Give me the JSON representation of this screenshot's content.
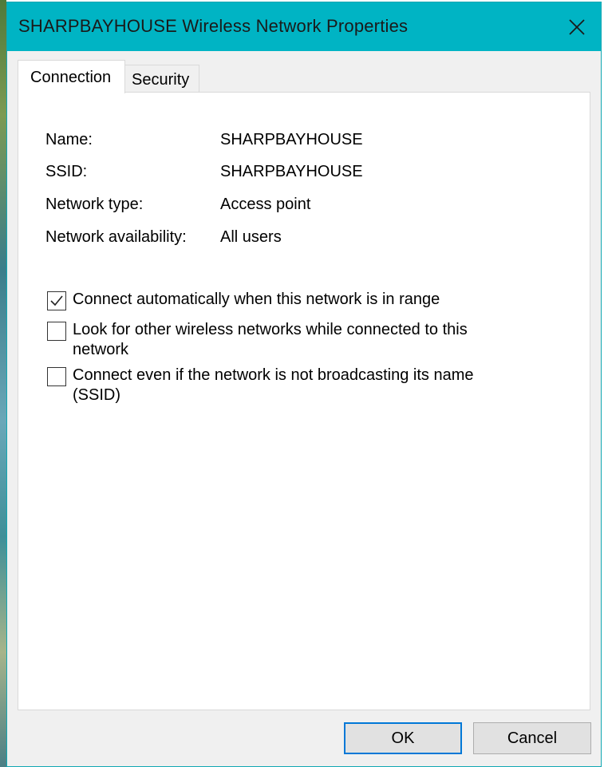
{
  "window": {
    "title": "SHARPBAYHOUSE Wireless Network Properties"
  },
  "icons": {
    "close": "close-icon",
    "check": "checkmark-icon"
  },
  "tabs": [
    {
      "label": "Connection",
      "active": true
    },
    {
      "label": "Security",
      "active": false
    }
  ],
  "properties": [
    {
      "label": "Name:",
      "value": "SHARPBAYHOUSE"
    },
    {
      "label": "SSID:",
      "value": "SHARPBAYHOUSE"
    },
    {
      "label": "Network type:",
      "value": "Access point"
    },
    {
      "label": "Network availability:",
      "value": "All users"
    }
  ],
  "options": [
    {
      "label": "Connect automatically when this network is in range",
      "checked": true
    },
    {
      "label": "Look for other wireless networks while connected to this network",
      "checked": false
    },
    {
      "label": "Connect even if the network is not broadcasting its name (SSID)",
      "checked": false
    }
  ],
  "buttons": {
    "ok": "OK",
    "cancel": "Cancel"
  },
  "colors": {
    "titlebar": "#00b4c4",
    "accent": "#0078d7"
  }
}
